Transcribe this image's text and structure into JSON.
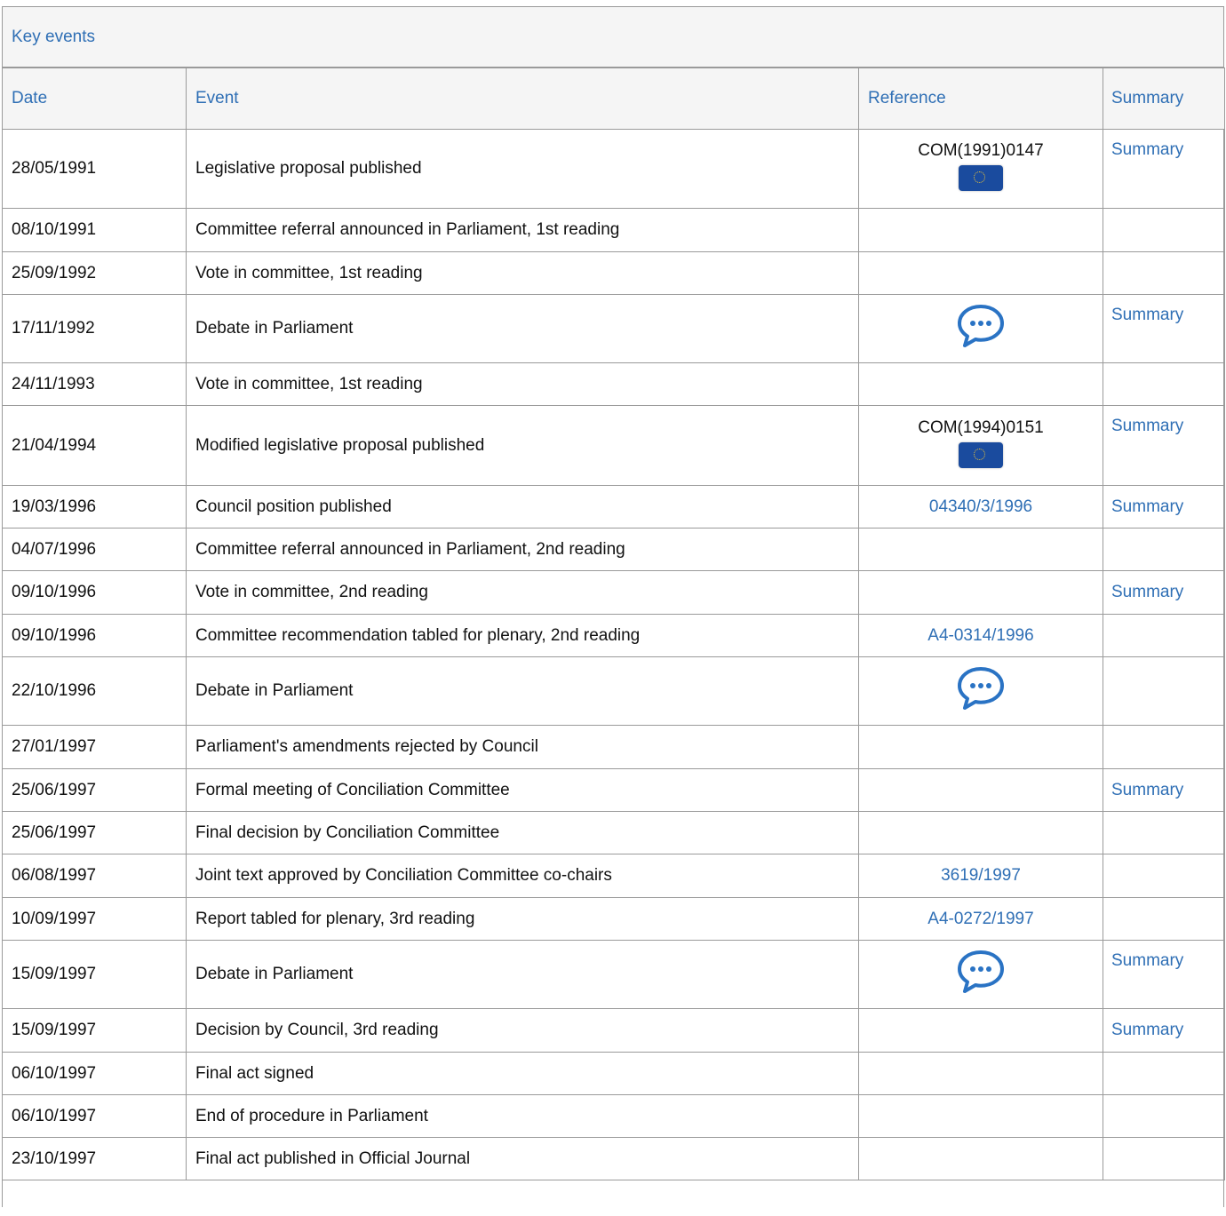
{
  "title": "Key events",
  "headers": {
    "date": "Date",
    "event": "Event",
    "reference": "Reference",
    "summary": "Summary"
  },
  "colors": {
    "link": "#2f6fb5",
    "header_bg": "#f5f5f5",
    "border": "#9a9a9a"
  },
  "rows": [
    {
      "date": "28/05/1991",
      "event": "Legislative proposal published",
      "ref_text": "COM(1991)0147",
      "ref_icon": "eu-flag-icon",
      "summary": "Summary"
    },
    {
      "date": "08/10/1991",
      "event": "Committee referral announced in Parliament, 1st reading"
    },
    {
      "date": "25/09/1992",
      "event": "Vote in committee, 1st reading"
    },
    {
      "date": "17/11/1992",
      "event": "Debate in Parliament",
      "ref_icon": "debate-speech-bubble-icon",
      "summary": "Summary"
    },
    {
      "date": "24/11/1993",
      "event": "Vote in committee, 1st reading"
    },
    {
      "date": "21/04/1994",
      "event": "Modified legislative proposal published",
      "ref_text": "COM(1994)0151",
      "ref_icon": "eu-flag-icon",
      "summary": "Summary"
    },
    {
      "date": "19/03/1996",
      "event": "Council position published",
      "ref_link": "04340/3/1996",
      "summary": "Summary"
    },
    {
      "date": "04/07/1996",
      "event": "Committee referral announced in Parliament, 2nd reading"
    },
    {
      "date": "09/10/1996",
      "event": "Vote in committee, 2nd reading",
      "summary": "Summary"
    },
    {
      "date": "09/10/1996",
      "event": "Committee recommendation tabled for plenary, 2nd reading",
      "ref_link": "A4-0314/1996"
    },
    {
      "date": "22/10/1996",
      "event": "Debate in Parliament",
      "ref_icon": "debate-speech-bubble-icon"
    },
    {
      "date": "27/01/1997",
      "event": "Parliament's amendments rejected by Council"
    },
    {
      "date": "25/06/1997",
      "event": "Formal meeting of Conciliation Committee",
      "summary": "Summary"
    },
    {
      "date": "25/06/1997",
      "event": "Final decision by Conciliation Committee"
    },
    {
      "date": "06/08/1997",
      "event": "Joint text approved by Conciliation Committee co-chairs",
      "ref_link": "3619/1997"
    },
    {
      "date": "10/09/1997",
      "event": "Report tabled for plenary, 3rd reading",
      "ref_link": "A4-0272/1997"
    },
    {
      "date": "15/09/1997",
      "event": "Debate in Parliament",
      "ref_icon": "debate-speech-bubble-icon",
      "summary": "Summary"
    },
    {
      "date": "15/09/1997",
      "event": "Decision by Council, 3rd reading",
      "summary": "Summary"
    },
    {
      "date": "06/10/1997",
      "event": "Final act signed"
    },
    {
      "date": "06/10/1997",
      "event": "End of procedure in Parliament"
    },
    {
      "date": "23/10/1997",
      "event": "Final act published in Official Journal"
    }
  ]
}
